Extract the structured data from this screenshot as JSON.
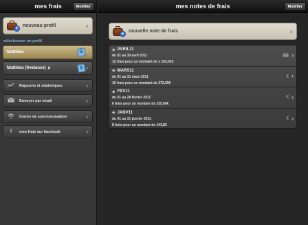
{
  "left": {
    "header": {
      "title": "mes frais",
      "edit_label": "Modifier"
    },
    "new_profile": {
      "label": "nouveau profil"
    },
    "select_profile_label": "sélectionner un profil",
    "profiles": [
      {
        "name": "Matthieu",
        "locked": false,
        "selected": true
      },
      {
        "name": "Matthieu (freelance)",
        "locked": true,
        "selected": false
      }
    ],
    "menu": [
      {
        "label": "Rapports et statistiques",
        "icon": "chart-icon"
      },
      {
        "label": "Envoyer par email",
        "icon": "mail-icon"
      },
      {
        "label": "Centre de synchronisation",
        "icon": "wifi-icon"
      },
      {
        "label": "mes frais sur facebook",
        "icon": "facebook-icon"
      }
    ]
  },
  "right": {
    "header": {
      "title": "mes notes de frais",
      "edit_label": "Modifier"
    },
    "new_note": {
      "label": "nouvelle note de frais"
    },
    "notes": [
      {
        "name": "AVRIL11",
        "range": "du 01 au 30 avril 2011",
        "summary": "12 frais pour un montant de 1 163,62€",
        "status_icon": "mail-sent-icon"
      },
      {
        "name": "MARS11",
        "range": "du 01 au 31 mars 2011",
        "summary": "10 frais pour un montant de 372,05€",
        "status_icon": "euro-icon"
      },
      {
        "name": "FEV11",
        "range": "du 01 au 28 février 2011",
        "summary": "6 frais pour un montant de 235,66€",
        "status_icon": "euro-icon"
      },
      {
        "name": "JANV11",
        "range": "du 01 au 31 janvier 2011",
        "summary": "8 frais pour un montant de 143,8€",
        "status_icon": "euro-icon"
      }
    ]
  }
}
